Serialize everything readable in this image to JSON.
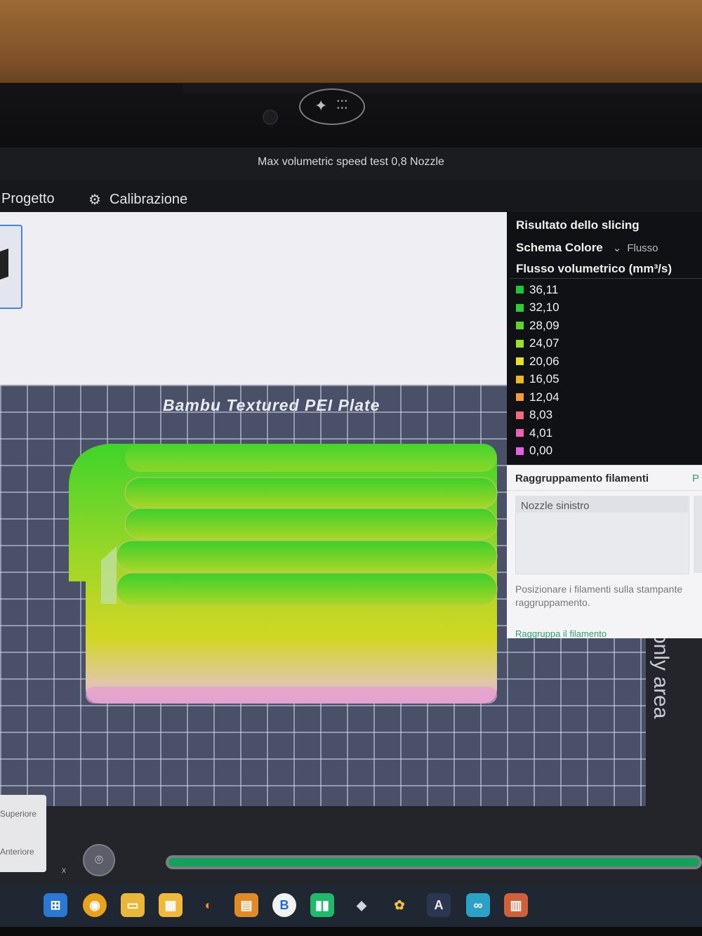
{
  "window": {
    "title": "Max volumetric speed test 0,8 Nozzle"
  },
  "menu": {
    "project": "Progetto",
    "calibration": "Calibrazione"
  },
  "plate": {
    "label": "Bambu Textured PEI Plate",
    "side_text": "only area"
  },
  "slicing_panel": {
    "title": "Risultato dello slicing",
    "scheme_label": "Schema Colore",
    "scheme_value": "Flusso",
    "flow_label": "Flusso volumetrico (mm³/s)",
    "legend": [
      {
        "value": "36,11",
        "color": "#16c93a"
      },
      {
        "value": "32,10",
        "color": "#2bd12f"
      },
      {
        "value": "28,09",
        "color": "#5ad627"
      },
      {
        "value": "24,07",
        "color": "#9fe020"
      },
      {
        "value": "20,06",
        "color": "#e6e21c"
      },
      {
        "value": "16,05",
        "color": "#f0b81e"
      },
      {
        "value": "12,04",
        "color": "#f39a3a"
      },
      {
        "value": "8,03",
        "color": "#f36a7a"
      },
      {
        "value": "4,01",
        "color": "#ef5fb5"
      },
      {
        "value": "0,00",
        "color": "#ea5fe0"
      }
    ]
  },
  "filament_panel": {
    "title": "Raggruppamento filamenti",
    "tab_right": "P",
    "nozzle_left": "Nozzle sinistro",
    "description_line1": "Posizionare i filamenti sulla stampante",
    "description_line2": "raggruppamento.",
    "link": "Raggruppa il filamento"
  },
  "view_controls": {
    "top": "Superiore",
    "front": "Anteriore",
    "close": "x"
  },
  "layer_slider": {
    "progress": 1.0
  },
  "colors": {
    "accent": "#14a15a",
    "panel_dark": "#101114"
  }
}
